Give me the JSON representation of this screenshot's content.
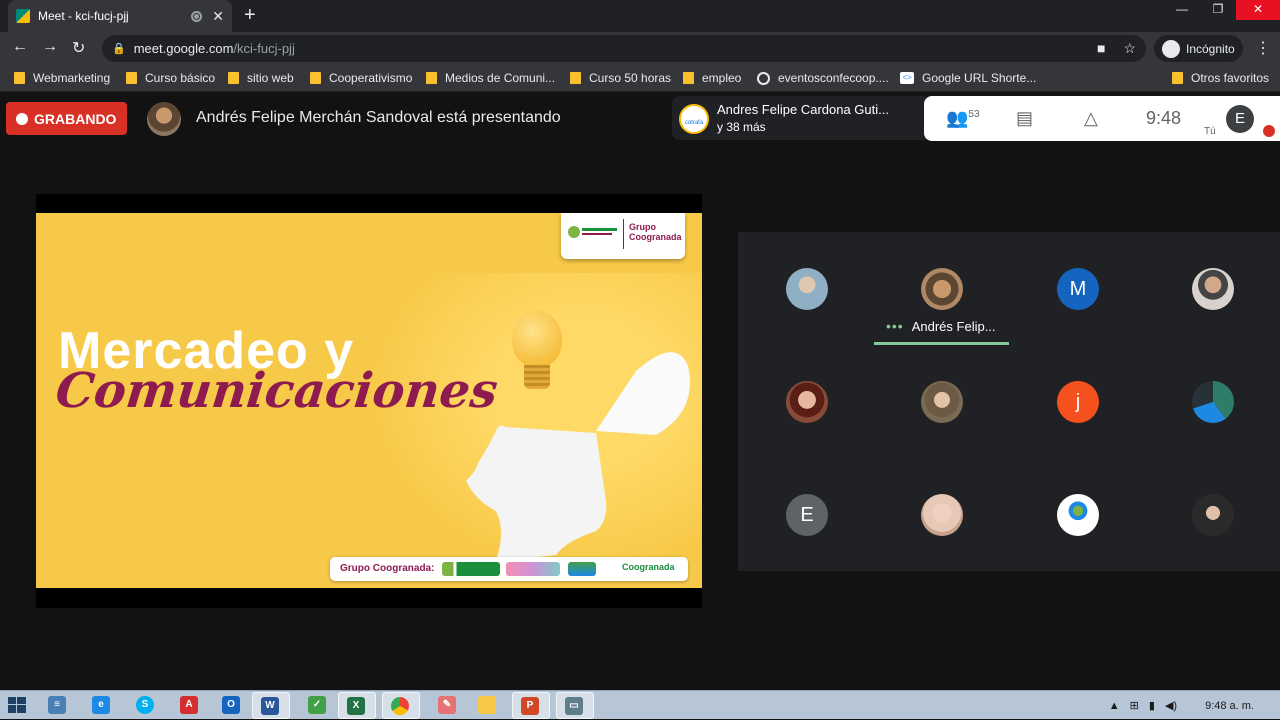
{
  "browser": {
    "tab_title": "Meet - kci-fucj-pjj",
    "url_host": "meet.google.com",
    "url_path": "/kci-fucj-pjj",
    "incognito_label": "Incógnito"
  },
  "bookmarks": [
    {
      "label": "Webmarketing",
      "icon": "folder-icon"
    },
    {
      "label": "Curso básico",
      "icon": "folder-icon"
    },
    {
      "label": "sitio web",
      "icon": "folder-icon"
    },
    {
      "label": "Cooperativismo",
      "icon": "folder-icon"
    },
    {
      "label": "Medios de Comuni...",
      "icon": "folder-icon"
    },
    {
      "label": "Curso 50 horas",
      "icon": "folder-icon"
    },
    {
      "label": "empleo",
      "icon": "folder-icon"
    },
    {
      "label": "eventosconfecoop....",
      "icon": "globe-icon"
    },
    {
      "label": "Google URL Shorte...",
      "icon": "google-url-icon"
    },
    {
      "label": "Otros favoritos",
      "icon": "folder-icon"
    }
  ],
  "meet": {
    "recording_label": "GRABANDO",
    "presenting_text": "Andrés Felipe Merchán Sandoval está presentando",
    "speaker_name": "Andres Felipe Cardona Guti...",
    "speaker_more": "y 38 más",
    "speaker_logo_text": "cotrafa",
    "participant_count": "53",
    "clock": "9:48",
    "self_label": "Tú",
    "self_initial": "E",
    "active_participant_name": "Andrés Felip..."
  },
  "slide": {
    "title_line1": "Mercadeo y",
    "title_line2": "Comunicaciones",
    "logo_text": "Grupo Coogranada",
    "footer_label": "Grupo Coogranada:",
    "footer_brand": "Coogranada"
  },
  "participants": [
    {
      "initial": "",
      "color": "#8fb0c4"
    },
    {
      "initial": "",
      "color": "#b08866"
    },
    {
      "initial": "M",
      "color": "#1565c0"
    },
    {
      "initial": "",
      "color": "#d9d2cc"
    },
    {
      "initial": "",
      "color": "#8a4a3a"
    },
    {
      "initial": "",
      "color": "#7b6a55"
    },
    {
      "initial": "j",
      "color": "#f4511e"
    },
    {
      "initial": "",
      "color": "#2e7d6a"
    },
    {
      "initial": "E",
      "color": "#5f6368"
    },
    {
      "initial": "",
      "color": "#e7c9b8"
    },
    {
      "initial": "",
      "color": "#ffffff"
    },
    {
      "initial": "",
      "color": "#2a2a2a"
    }
  ],
  "taskbar": {
    "time": "9:48 a. m.",
    "apps": [
      "windows-explorer-icon",
      "internet-explorer-icon",
      "skype-icon",
      "acrobat-icon",
      "outlook-icon",
      "word-icon",
      "app-icon",
      "excel-icon",
      "chrome-icon",
      "paint-icon",
      "explorer-folder-icon",
      "powerpoint-icon",
      "window-icon"
    ]
  }
}
